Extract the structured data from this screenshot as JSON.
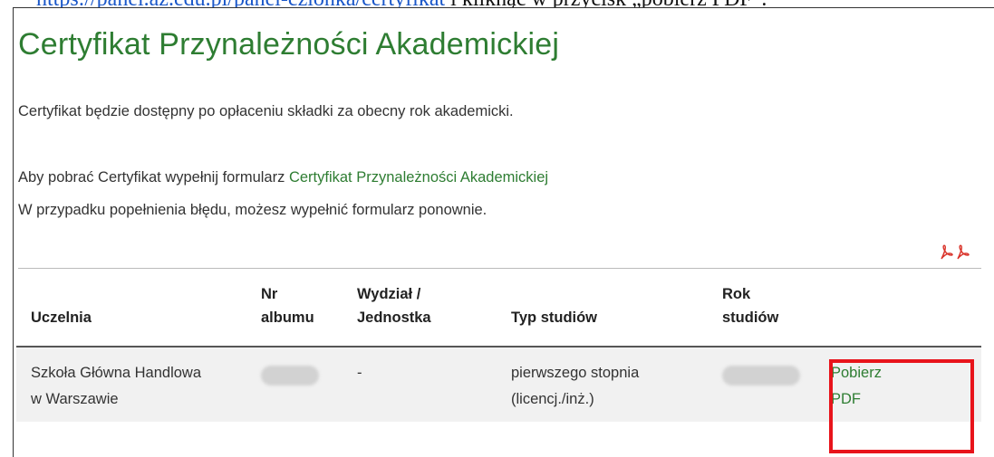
{
  "doc": {
    "url_text": "https://panel.az.edu.pl/panel-czlonka/certyfikat",
    "after_text": " i kliknąć w przycisk „pobierz PDF”."
  },
  "page": {
    "title": "Certyfikat Przynależności Akademickiej",
    "note": "Certyfikat będzie dostępny po opłaceniu składki za obecny rok akademicki.",
    "form_prefix": "Aby pobrać Certyfikat wypełnij formularz ",
    "form_link": "Certyfikat Przynależności Akademickiej",
    "retry_text": "W przypadku popełnienia błędu, możesz wypełnić formularz ponownie."
  },
  "table": {
    "headers": {
      "uczelnia": "Uczelnia",
      "nr_albumu_1": "Nr",
      "nr_albumu_2": "albumu",
      "wydzial_1": "Wydział /",
      "wydzial_2": "Jednostka",
      "typ": "Typ studiów",
      "rok_1": "Rok",
      "rok_2": "studiów"
    },
    "row": {
      "uczelnia_1": "Szkoła Główna Handlowa",
      "uczelnia_2": "w Warszawie",
      "wydzial": "-",
      "typ_1": "pierwszego stopnia",
      "typ_2": "(licencj./inż.)",
      "action_1": "Pobierz",
      "action_2": "PDF"
    }
  },
  "colors": {
    "accent_green": "#2e7d32",
    "highlight_red": "#e8141b",
    "pdf_red": "#d9342b"
  },
  "icons": [
    "pdf-icon",
    "pdf-icon"
  ]
}
